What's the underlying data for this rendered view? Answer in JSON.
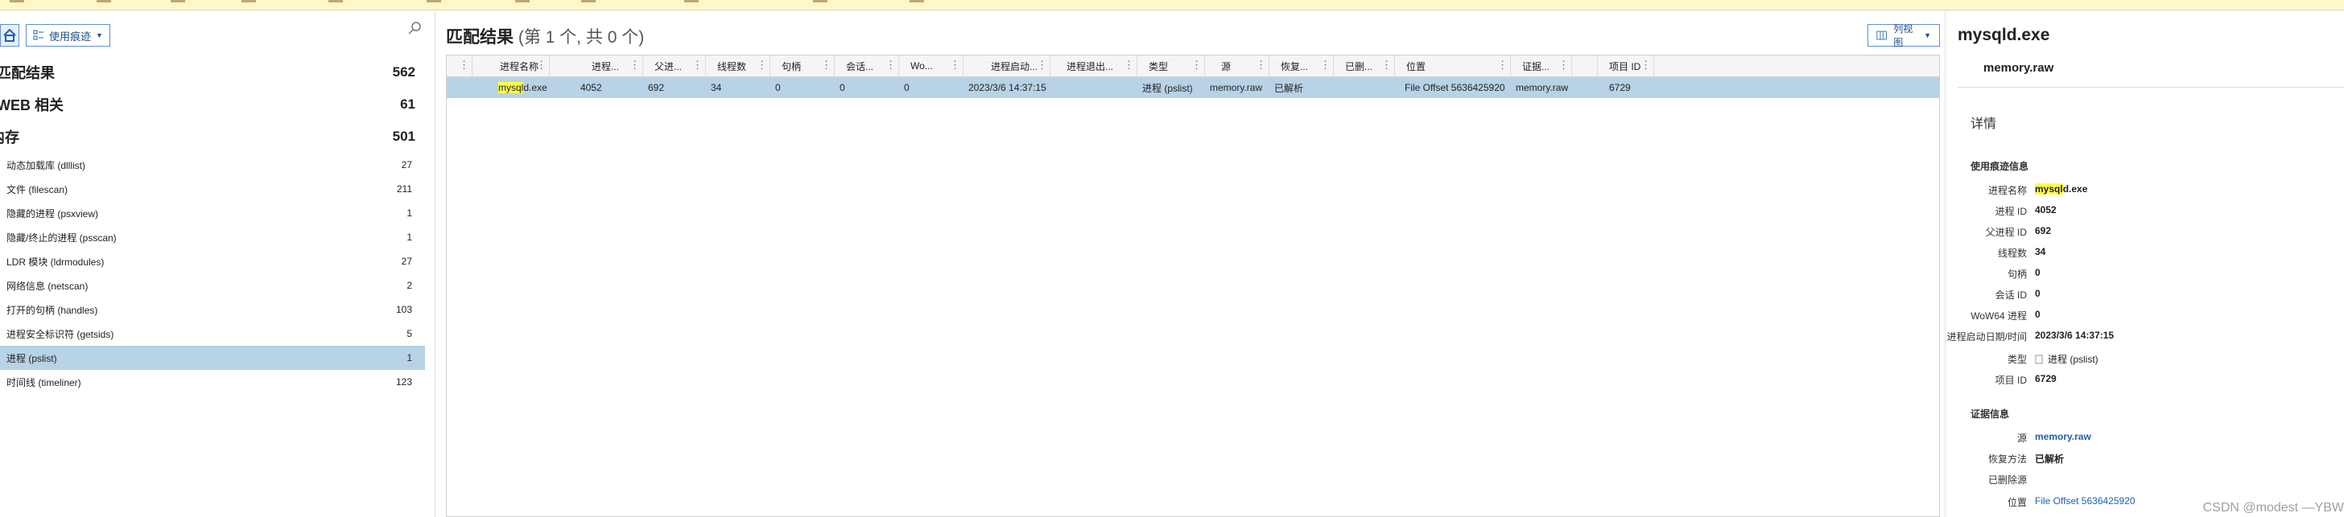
{
  "toolbar": {
    "view_label": "使用痕迹"
  },
  "categories": [
    {
      "label": "匹配结果",
      "count": "562"
    },
    {
      "label": "WEB 相关",
      "count": "61"
    },
    {
      "label": "内存",
      "count": "501"
    }
  ],
  "memory_items": [
    {
      "label": "动态加载库 (dlllist)",
      "count": "27"
    },
    {
      "label": "文件 (filescan)",
      "count": "211"
    },
    {
      "label": "隐藏的进程 (psxview)",
      "count": "1"
    },
    {
      "label": "隐藏/终止的进程 (psscan)",
      "count": "1"
    },
    {
      "label": "LDR 模块 (ldrmodules)",
      "count": "27"
    },
    {
      "label": "网络信息 (netscan)",
      "count": "2"
    },
    {
      "label": "打开的句柄 (handles)",
      "count": "103"
    },
    {
      "label": "进程安全标识符 (getsids)",
      "count": "5"
    },
    {
      "label": "进程 (pslist)",
      "count": "1"
    },
    {
      "label": "时间线 (timeliner)",
      "count": "123"
    }
  ],
  "results": {
    "title": "匹配结果",
    "subtitle": "(第 1 个, 共 0 个)",
    "column_view_label": "列视图",
    "columns": [
      "进程名称",
      "进程...",
      "父进...",
      "线程数",
      "句柄",
      "会话...",
      "Wo...",
      "进程启动...",
      "进程退出...",
      "类型",
      "源",
      "恢复...",
      "已删...",
      "位置",
      "证据...",
      "项目 ID"
    ],
    "row": {
      "name_hl": "mysql",
      "name_rest": "d.exe",
      "pid": "4052",
      "ppid": "692",
      "threads": "34",
      "handles": "0",
      "session": "0",
      "wow64": "0",
      "start": "2023/3/6 14:37:15",
      "exit": "",
      "type": "进程 (pslist)",
      "source": "memory.raw",
      "recovery": "已解析",
      "deleted": "",
      "location": "File Offset 5636425920",
      "evidence": "memory.raw",
      "item_id": "6729"
    }
  },
  "detail": {
    "title": "mysqld.exe",
    "file": "memory.raw",
    "heading": "详情",
    "section_usage": "使用痕迹信息",
    "section_evidence": "证据信息",
    "props": [
      {
        "key": "进程名称",
        "value_hl": "mysql",
        "value": "d.exe"
      },
      {
        "key": "进程 ID",
        "value": "4052"
      },
      {
        "key": "父进程 ID",
        "value": "692"
      },
      {
        "key": "线程数",
        "value": "34"
      },
      {
        "key": "句柄",
        "value": "0"
      },
      {
        "key": "会话 ID",
        "value": "0"
      },
      {
        "key": "WoW64 进程",
        "value": "0"
      },
      {
        "key": "进程启动日期/时间",
        "value": "2023/3/6 14:37:15"
      },
      {
        "key": "类型",
        "value": "进程 (pslist)"
      },
      {
        "key": "项目 ID",
        "value": "6729"
      }
    ],
    "evidence_props": [
      {
        "key": "源",
        "value": "memory.raw"
      },
      {
        "key": "恢复方法",
        "value": "已解析"
      },
      {
        "key": "已删除源",
        "value": ""
      },
      {
        "key": "位置",
        "value": "File Offset 5636425920"
      }
    ]
  },
  "watermark": "CSDN @modest —YBW",
  "colors": {
    "selected_row": "#b8d3e6",
    "highlight": "#ffff4a",
    "link": "#1f5fb0",
    "accent": "#5b8fd6"
  }
}
